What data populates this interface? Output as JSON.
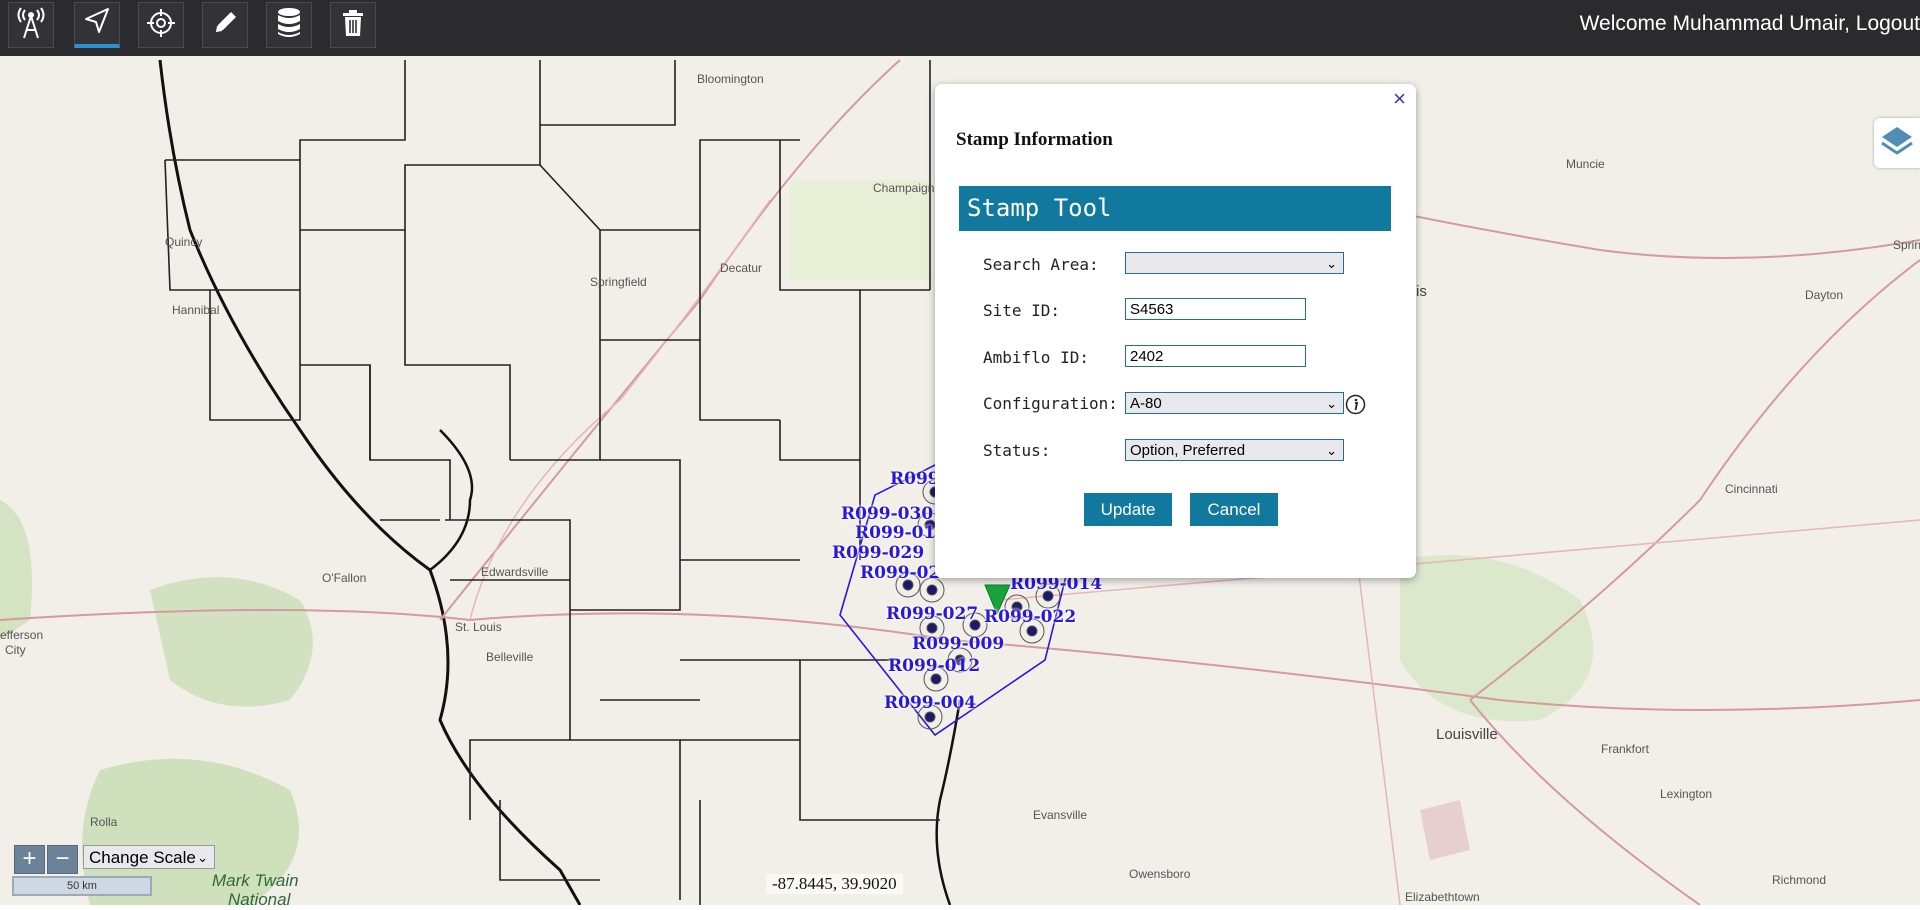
{
  "toolbar": {
    "buttons": [
      {
        "icon": "tower-icon"
      },
      {
        "icon": "navigate-icon",
        "active": true
      },
      {
        "icon": "crosshair-icon"
      },
      {
        "icon": "pencil-icon"
      },
      {
        "icon": "database-icon"
      },
      {
        "icon": "trash-icon"
      }
    ],
    "welcome": "Welcome Muhammad Umair, Logout"
  },
  "map": {
    "cities": [
      "Bloomington",
      "Champaign",
      "Quincy",
      "Hannibal",
      "Springfield",
      "Decatur",
      "O'Fallon",
      "Edwardsville",
      "St. Louis",
      "Belleville",
      "Rolla",
      "Muncie",
      "Dayton",
      "Cincinnati",
      "Louisville",
      "Frankfort",
      "Lexington",
      "Evansville",
      "Owensboro",
      "Richmond",
      "Elizabethtown",
      "Springfi"
    ],
    "partial_labels": [
      "efferson",
      "City",
      "is"
    ],
    "park": [
      "Mark Twain",
      "National"
    ],
    "sites": [
      "R099",
      "R099-030",
      "R099-01",
      "R099-029",
      "R099-02",
      "R099-014",
      "R099-027",
      "R099-022",
      "R099-009",
      "R099-012",
      "R099-004"
    ]
  },
  "modal": {
    "close": "×",
    "title": "Stamp Information",
    "banner": "Stamp Tool",
    "search_area_label": "Search Area:",
    "search_area_value": "",
    "site_id_label": "Site ID:",
    "site_id_value": "S4563",
    "ambiflo_label": "Ambiflo ID:",
    "ambiflo_value": "2402",
    "config_label": "Configuration:",
    "config_value": "A-80",
    "status_label": "Status:",
    "status_value": "Option, Preferred",
    "update": "Update",
    "cancel": "Cancel"
  },
  "controls": {
    "zoom_in": "+",
    "zoom_out": "−",
    "change_scale": "Change Scale",
    "scale_text": "50 km",
    "coords": "-87.8445, 39.9020"
  }
}
